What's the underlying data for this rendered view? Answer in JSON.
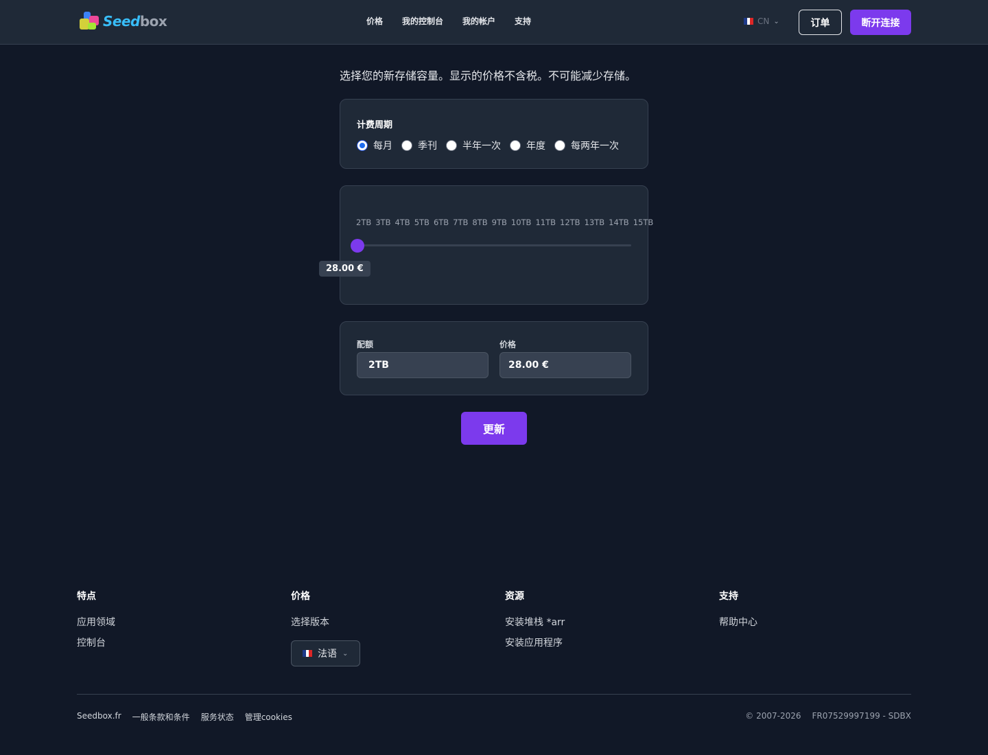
{
  "header": {
    "logo_seed": "Seed",
    "logo_box": "box",
    "nav": [
      "价格",
      "我的控制台",
      "我的帐户",
      "支持"
    ],
    "lang_code": "CN",
    "order_label": "订单",
    "logout_label": "断开连接"
  },
  "main": {
    "intro": "选择您的新存储容量。显示的价格不含税。不可能减少存储。",
    "billing": {
      "label": "计费周期",
      "options": [
        "每月",
        "季刊",
        "半年一次",
        "年度",
        "每两年一次"
      ],
      "selected": "每月"
    },
    "slider": {
      "ticks": [
        "2TB",
        "3TB",
        "4TB",
        "5TB",
        "6TB",
        "7TB",
        "8TB",
        "9TB",
        "10TB",
        "11TB",
        "12TB",
        "13TB",
        "14TB",
        "15TB"
      ],
      "value": "2TB",
      "tooltip": "28.00 €"
    },
    "quota": {
      "label": "配额",
      "value": "2TB"
    },
    "price": {
      "label": "价格",
      "value": "28.00 €"
    },
    "update_label": "更新"
  },
  "footer": {
    "columns": [
      {
        "title": "特点",
        "links": [
          "应用领域",
          "控制台"
        ]
      },
      {
        "title": "价格",
        "links": [
          "选择版本"
        ]
      },
      {
        "title": "资源",
        "links": [
          "安装堆栈 *arr",
          "安装应用程序"
        ]
      },
      {
        "title": "支持",
        "links": [
          "帮助中心"
        ]
      }
    ],
    "language_button": "法语",
    "bottom_links": [
      "Seedbox.fr",
      "一般条款和条件",
      "服务状态",
      "管理cookies"
    ],
    "copyright": "© 2007-2026",
    "company_id": "FR07529997199 - SDBX"
  },
  "colors": {
    "accent": "#7c3aed",
    "background": "#111827",
    "card": "#1f2937"
  }
}
